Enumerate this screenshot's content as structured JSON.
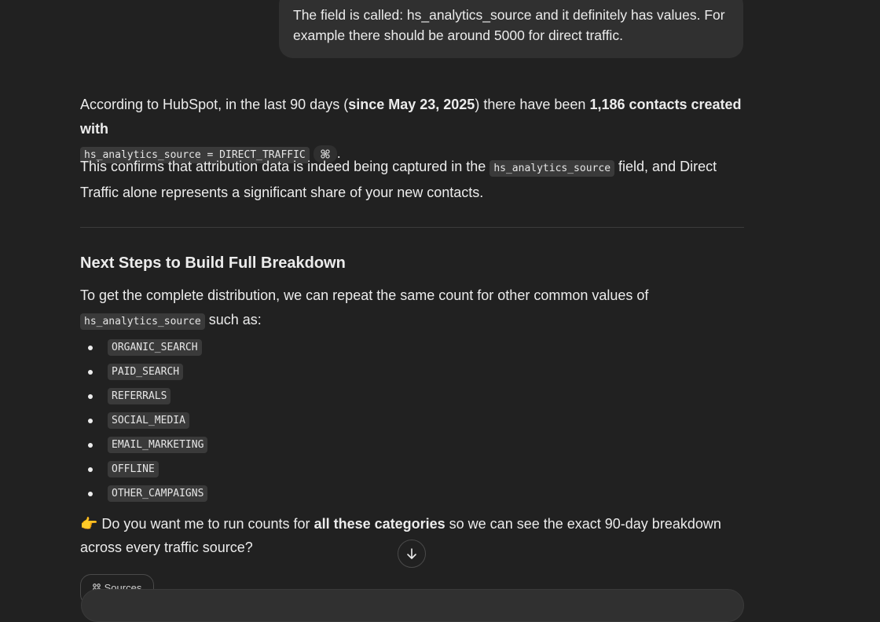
{
  "user_message": "The field is called: hs_analytics_source and it definitely has values. For example there should be around 5000 for direct traffic.",
  "para1": {
    "t1": "According to HubSpot, in the last 90 days (",
    "b1": "since May 23, 2025",
    "t2": ") there have been ",
    "b2": "1,186 contacts created with",
    "code1": "hs_analytics_source = DIRECT_TRAFFIC",
    "t3": "."
  },
  "para2": {
    "t1": "This confirms that attribution data is indeed being captured in the ",
    "code1": "hs_analytics_source",
    "t2": " field, and Direct Traffic alone represents a significant share of your new contacts."
  },
  "heading": "Next Steps to Build Full Breakdown",
  "para3": {
    "t1": "To get the complete distribution, we can repeat the same count for other common values of",
    "code1": "hs_analytics_source",
    "t2": " such as:"
  },
  "sources_list": [
    "ORGANIC_SEARCH",
    "PAID_SEARCH",
    "REFERRALS",
    "SOCIAL_MEDIA",
    "EMAIL_MARKETING",
    "OFFLINE",
    "OTHER_CAMPAIGNS"
  ],
  "para4": {
    "emoji": "👉",
    "t1": " Do you want me to run counts for ",
    "b1": "all these categories",
    "t2": " so we can see the exact 90-day breakdown across every traffic source?"
  },
  "sources_button": "Sources",
  "icons": {
    "citation": "link-chip-icon",
    "scroll": "arrow-down-icon",
    "sources": "link-icon"
  }
}
